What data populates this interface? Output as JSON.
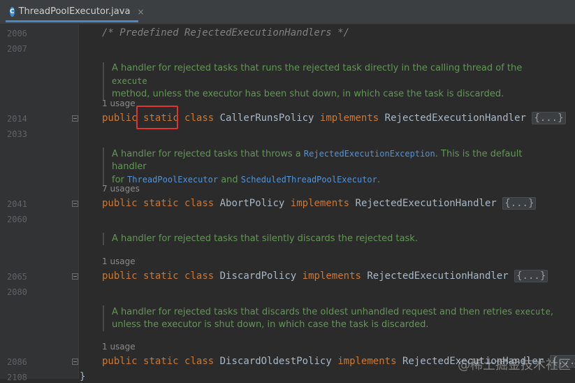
{
  "tab": {
    "icon_letter": "C",
    "title": "ThreadPoolExecutor.java",
    "close": "×"
  },
  "line_numbers": [
    "2006",
    "2007",
    "2014",
    "2033",
    "2041",
    "2060",
    "2065",
    "2080",
    "2086",
    "2108"
  ],
  "comment_line": "/* Predefined RejectedExecutionHandlers */",
  "blocks": [
    {
      "doc_lines": [
        [
          "A handler for rejected tasks that runs the rejected task directly in the calling thread of the ",
          "execute"
        ],
        [
          "method, unless the executor has been shut down, in which case the task is discarded."
        ]
      ],
      "usage": "1 usage",
      "class_name": "CallerRunsPolicy",
      "interface": "RejectedExecutionHandler"
    },
    {
      "doc_line1_a": "A handler for rejected tasks that throws a ",
      "doc_line1_link": "RejectedExecutionException",
      "doc_line1_b": ". This is the default handler",
      "doc_line2_a": "for ",
      "doc_line2_link1": "ThreadPoolExecutor",
      "doc_line2_b": " and ",
      "doc_line2_link2": "ScheduledThreadPoolExecutor",
      "doc_line2_c": ".",
      "usage": "7 usages",
      "class_name": "AbortPolicy",
      "interface": "RejectedExecutionHandler"
    },
    {
      "doc_line1": "A handler for rejected tasks that silently discards the rejected task.",
      "usage": "1 usage",
      "class_name": "DiscardPolicy",
      "interface": "RejectedExecutionHandler"
    },
    {
      "doc_line1_a": "A handler for rejected tasks that discards the oldest unhandled request and then retries ",
      "doc_line1_code": "execute",
      "doc_line1_b": ",",
      "doc_line2": "unless the executor is shut down, in which case the task is discarded.",
      "usage": "1 usage",
      "class_name": "DiscardOldestPolicy",
      "interface": "RejectedExecutionHandler"
    }
  ],
  "keywords": {
    "public": "public",
    "static": "static",
    "class": "class",
    "implements": "implements"
  },
  "folded": "{...}",
  "closing_brace": "}",
  "watermark": "@稀土掘金技术社区"
}
